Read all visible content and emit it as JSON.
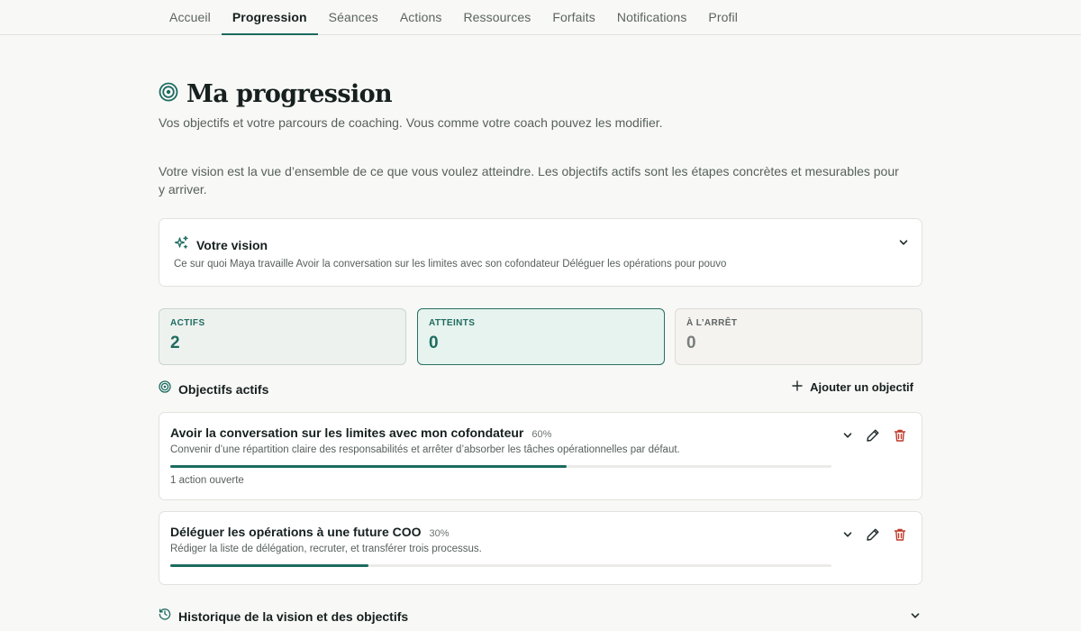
{
  "nav": {
    "tabs": [
      {
        "label": "Accueil"
      },
      {
        "label": "Progression"
      },
      {
        "label": "Séances"
      },
      {
        "label": "Actions"
      },
      {
        "label": "Ressources"
      },
      {
        "label": "Forfaits"
      },
      {
        "label": "Notifications"
      },
      {
        "label": "Profil"
      }
    ],
    "active_tab": "Progression"
  },
  "header": {
    "icon": "target-icon",
    "title": "Ma progression",
    "subtitle": "Vos objectifs et votre parcours de coaching. Vous comme votre coach pouvez les modifier."
  },
  "intro": "Votre vision est la vue d’ensemble de ce que vous voulez atteindre. Les objectifs actifs sont les étapes concrètes et mesurables pour y arriver.",
  "vision": {
    "icon": "sparkles-icon",
    "label": "Votre vision",
    "text": "Ce sur quoi Maya travaille Avoir la conversation sur les limites avec son cofondateur Déléguer les opérations pour pouvo"
  },
  "stats": [
    {
      "label": "ACTIFS",
      "value": "2"
    },
    {
      "label": "ATTEINTS",
      "value": "0"
    },
    {
      "label": "À L’ARRÊT",
      "value": "0"
    }
  ],
  "objectives": {
    "title": "Objectifs actifs",
    "add_label": "Ajouter un objectif",
    "goals": [
      {
        "title": "Avoir la conversation sur les limites avec mon cofondateur",
        "percent_label": "60%",
        "progress": 0.6,
        "description": "Convenir d’une répartition claire des responsabilités et arrêter d’absorber les tâches opérationnelles par défaut.",
        "footer": "1 action ouverte"
      },
      {
        "title": "Déléguer les opérations à une future COO",
        "percent_label": "30%",
        "progress": 0.3,
        "description": "Rédiger la liste de délégation, recruter, et transférer trois processus."
      }
    ]
  },
  "history": {
    "icon": "history-icon",
    "title": "Historique de la vision et des objectifs"
  },
  "colors": {
    "accent": "#1c6b60",
    "danger": "#c0392b",
    "background": "#f8f8f6"
  }
}
